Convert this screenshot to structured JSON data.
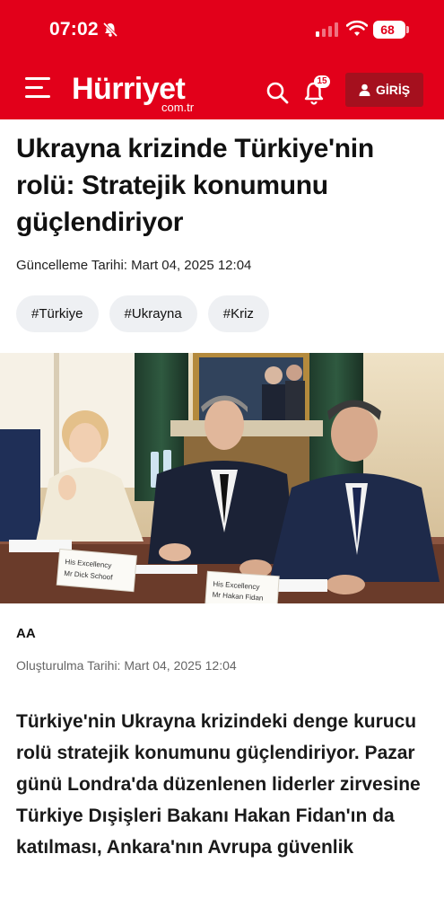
{
  "status_bar": {
    "time": "07:02",
    "battery": "68"
  },
  "header": {
    "logo_name": "Hürriyet",
    "logo_sub": "com.tr",
    "notification_count": "15",
    "login_label": "GİRİŞ"
  },
  "article": {
    "headline": "Ukrayna krizinde Türkiye'nin rolü: Stratejik konumunu güçlendiriyor",
    "updated": "Güncelleme Tarihi: Mart 04, 2025 12:04",
    "tags": [
      "#Türkiye",
      "#Ukrayna",
      "#Kriz"
    ],
    "photo": {
      "placard_left_line1": "His Excellency",
      "placard_left_line2": "Mr Dick Schoof",
      "placard_right_line1": "His Excellency",
      "placard_right_line2": "Mr Hakan Fidan"
    },
    "source": "AA",
    "created": "Oluşturulma Tarihi: Mart 04, 2025 12:04",
    "lead": "Türkiye'nin Ukrayna krizindeki denge kurucu rolü stratejik konumunu güçlendiriyor. Pazar günü Londra'da düzenlenen liderler zirvesine Türkiye Dışişleri Bakanı Hakan Fidan'ın da katılması, Ankara'nın Avrupa güvenlik"
  },
  "colors": {
    "brand_red": "#e2001a",
    "login_bg": "#a5101e",
    "tag_bg": "#eef0f3"
  }
}
